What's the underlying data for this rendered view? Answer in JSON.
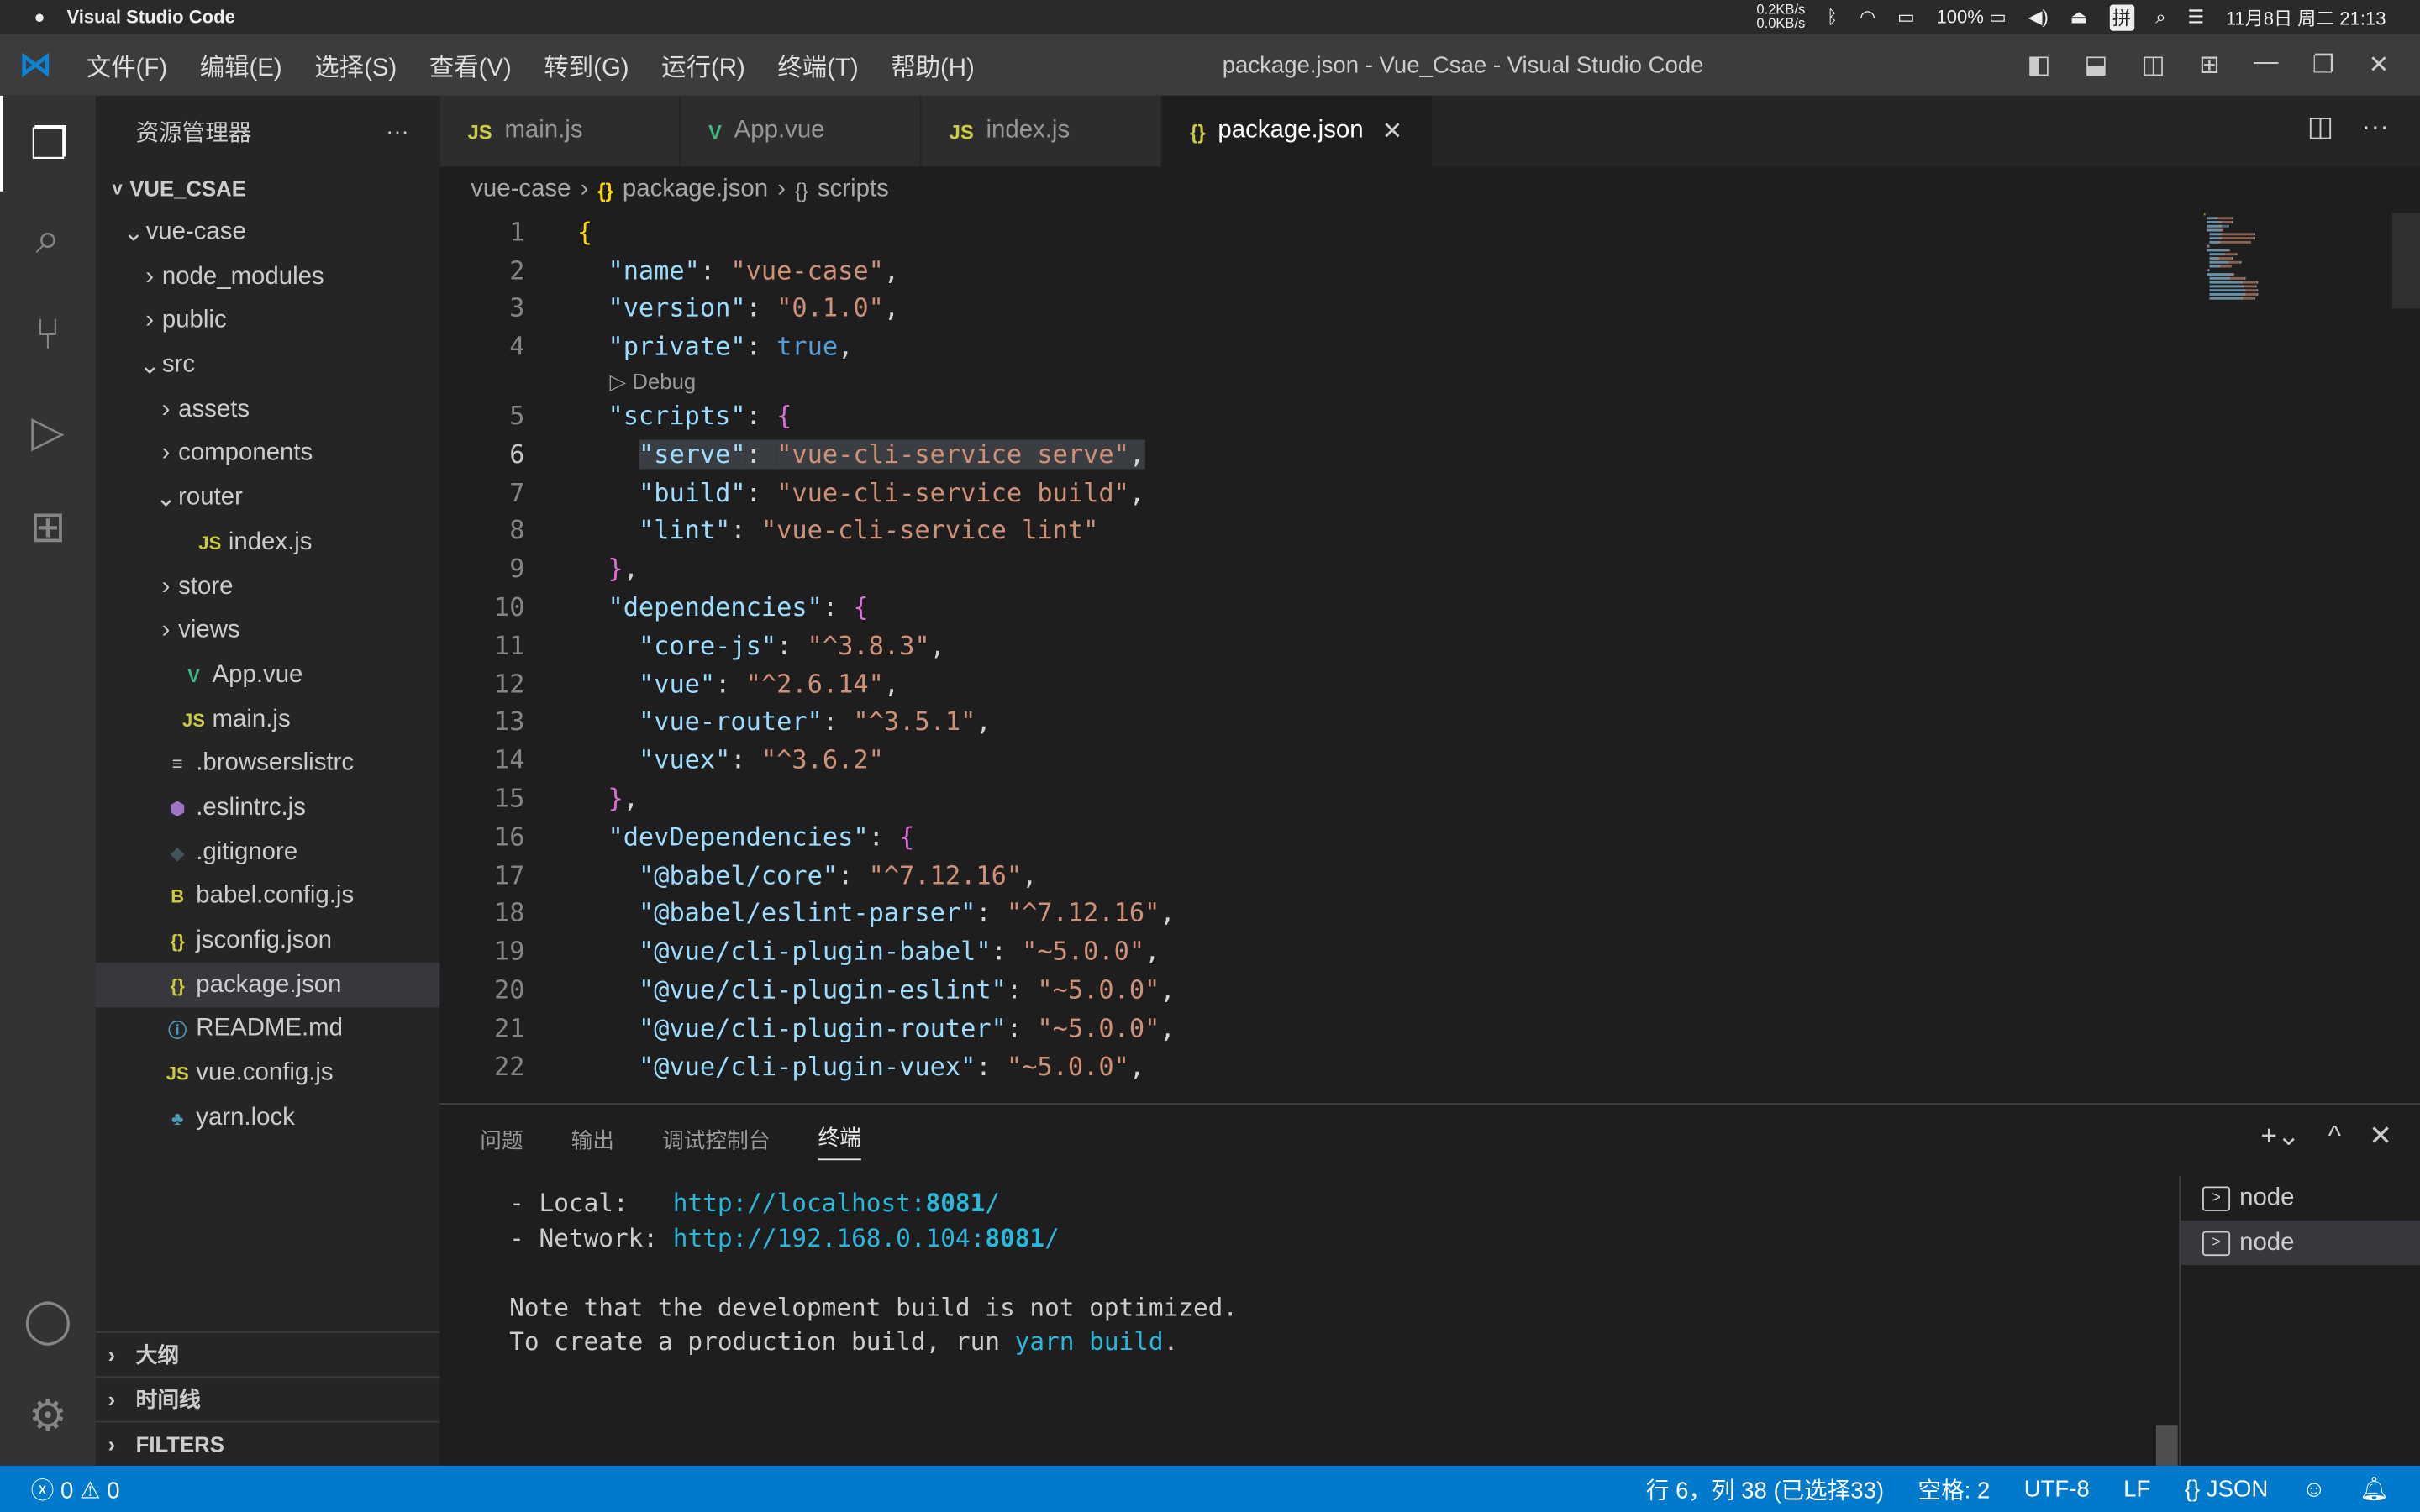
{
  "macbar": {
    "app": "Visual Studio Code",
    "net_up": "0.2KB/s",
    "net_down": "0.0KB/s",
    "battery": "100%",
    "ime": "拼",
    "clock": "11月8日 周二 21:13"
  },
  "titlebar": {
    "menus": [
      "文件(F)",
      "编辑(E)",
      "选择(S)",
      "查看(V)",
      "转到(G)",
      "运行(R)",
      "终端(T)",
      "帮助(H)"
    ],
    "title": "package.json - Vue_Csae - Visual Studio Code"
  },
  "sidebar": {
    "title": "资源管理器",
    "more": "···",
    "root": "VUE_CSAE",
    "tree": [
      {
        "label": "vue-case",
        "indent": 1,
        "chev": "v",
        "icon": "",
        "color": ""
      },
      {
        "label": "node_modules",
        "indent": 2,
        "chev": ">",
        "icon": "",
        "color": ""
      },
      {
        "label": "public",
        "indent": 2,
        "chev": ">",
        "icon": "",
        "color": ""
      },
      {
        "label": "src",
        "indent": 2,
        "chev": "v",
        "icon": "",
        "color": ""
      },
      {
        "label": "assets",
        "indent": 3,
        "chev": ">",
        "icon": "",
        "color": ""
      },
      {
        "label": "components",
        "indent": 3,
        "chev": ">",
        "icon": "",
        "color": ""
      },
      {
        "label": "router",
        "indent": 3,
        "chev": "v",
        "icon": "",
        "color": ""
      },
      {
        "label": "index.js",
        "indent": 4,
        "chev": "",
        "icon": "JS",
        "color": "#cbcb41"
      },
      {
        "label": "store",
        "indent": 3,
        "chev": ">",
        "icon": "",
        "color": ""
      },
      {
        "label": "views",
        "indent": 3,
        "chev": ">",
        "icon": "",
        "color": ""
      },
      {
        "label": "App.vue",
        "indent": 3,
        "chev": "",
        "icon": "V",
        "color": "#41b883"
      },
      {
        "label": "main.js",
        "indent": 3,
        "chev": "",
        "icon": "JS",
        "color": "#cbcb41"
      },
      {
        "label": ".browserslistrc",
        "indent": 2,
        "chev": "",
        "icon": "≡",
        "color": "#ccc"
      },
      {
        "label": ".eslintrc.js",
        "indent": 2,
        "chev": "",
        "icon": "⬢",
        "color": "#a074c4"
      },
      {
        "label": ".gitignore",
        "indent": 2,
        "chev": "",
        "icon": "◆",
        "color": "#41535b"
      },
      {
        "label": "babel.config.js",
        "indent": 2,
        "chev": "",
        "icon": "B",
        "color": "#cbcb41"
      },
      {
        "label": "jsconfig.json",
        "indent": 2,
        "chev": "",
        "icon": "{}",
        "color": "#cbcb41"
      },
      {
        "label": "package.json",
        "indent": 2,
        "chev": "",
        "icon": "{}",
        "color": "#cbcb41",
        "selected": true
      },
      {
        "label": "README.md",
        "indent": 2,
        "chev": "",
        "icon": "ⓘ",
        "color": "#519aba"
      },
      {
        "label": "vue.config.js",
        "indent": 2,
        "chev": "",
        "icon": "JS",
        "color": "#cbcb41"
      },
      {
        "label": "yarn.lock",
        "indent": 2,
        "chev": "",
        "icon": "♣",
        "color": "#519aba"
      }
    ],
    "sections": [
      "大纲",
      "时间线",
      "FILTERS"
    ]
  },
  "tabs": [
    {
      "label": "main.js",
      "icon": "JS",
      "color": "#cbcb41"
    },
    {
      "label": "App.vue",
      "icon": "V",
      "color": "#41b883"
    },
    {
      "label": "index.js",
      "icon": "JS",
      "color": "#cbcb41"
    },
    {
      "label": "package.json",
      "icon": "{}",
      "color": "#cbcb41",
      "active": true
    }
  ],
  "breadcrumb": [
    "vue-case",
    "package.json",
    "scripts"
  ],
  "codelens": "Debug",
  "code": [
    [
      [
        "{",
        "y"
      ]
    ],
    [
      [
        "  ",
        "w"
      ],
      [
        "\"name\"",
        "k"
      ],
      [
        ": ",
        "w"
      ],
      [
        "\"vue-case\"",
        "s"
      ],
      [
        ",",
        "w"
      ]
    ],
    [
      [
        "  ",
        "w"
      ],
      [
        "\"version\"",
        "k"
      ],
      [
        ": ",
        "w"
      ],
      [
        "\"0.1.0\"",
        "s"
      ],
      [
        ",",
        "w"
      ]
    ],
    [
      [
        "  ",
        "w"
      ],
      [
        "\"private\"",
        "k"
      ],
      [
        ": ",
        "w"
      ],
      [
        "true",
        "b"
      ],
      [
        ",",
        "w"
      ]
    ],
    [
      [
        "  ",
        "w"
      ],
      [
        "\"scripts\"",
        "k"
      ],
      [
        ": ",
        "w"
      ],
      [
        "{",
        "p"
      ]
    ],
    [
      [
        "    ",
        "w"
      ],
      [
        "\"serve\"",
        "k"
      ],
      [
        ": ",
        "w"
      ],
      [
        "\"vue-cli-service serve\"",
        "s"
      ],
      [
        ",",
        "w"
      ]
    ],
    [
      [
        "    ",
        "w"
      ],
      [
        "\"build\"",
        "k"
      ],
      [
        ": ",
        "w"
      ],
      [
        "\"vue-cli-service build\"",
        "s"
      ],
      [
        ",",
        "w"
      ]
    ],
    [
      [
        "    ",
        "w"
      ],
      [
        "\"lint\"",
        "k"
      ],
      [
        ": ",
        "w"
      ],
      [
        "\"vue-cli-service lint\"",
        "s"
      ]
    ],
    [
      [
        "  ",
        "w"
      ],
      [
        "}",
        "p"
      ],
      [
        ",",
        "w"
      ]
    ],
    [
      [
        "  ",
        "w"
      ],
      [
        "\"dependencies\"",
        "k"
      ],
      [
        ": ",
        "w"
      ],
      [
        "{",
        "p"
      ]
    ],
    [
      [
        "    ",
        "w"
      ],
      [
        "\"core-js\"",
        "k"
      ],
      [
        ": ",
        "w"
      ],
      [
        "\"^3.8.3\"",
        "s"
      ],
      [
        ",",
        "w"
      ]
    ],
    [
      [
        "    ",
        "w"
      ],
      [
        "\"vue\"",
        "k"
      ],
      [
        ": ",
        "w"
      ],
      [
        "\"^2.6.14\"",
        "s"
      ],
      [
        ",",
        "w"
      ]
    ],
    [
      [
        "    ",
        "w"
      ],
      [
        "\"vue-router\"",
        "k"
      ],
      [
        ": ",
        "w"
      ],
      [
        "\"^3.5.1\"",
        "s"
      ],
      [
        ",",
        "w"
      ]
    ],
    [
      [
        "    ",
        "w"
      ],
      [
        "\"vuex\"",
        "k"
      ],
      [
        ": ",
        "w"
      ],
      [
        "\"^3.6.2\"",
        "s"
      ]
    ],
    [
      [
        "  ",
        "w"
      ],
      [
        "}",
        "p"
      ],
      [
        ",",
        "w"
      ]
    ],
    [
      [
        "  ",
        "w"
      ],
      [
        "\"devDependencies\"",
        "k"
      ],
      [
        ": ",
        "w"
      ],
      [
        "{",
        "p"
      ]
    ],
    [
      [
        "    ",
        "w"
      ],
      [
        "\"@babel/core\"",
        "k"
      ],
      [
        ": ",
        "w"
      ],
      [
        "\"^7.12.16\"",
        "s"
      ],
      [
        ",",
        "w"
      ]
    ],
    [
      [
        "    ",
        "w"
      ],
      [
        "\"@babel/eslint-parser\"",
        "k"
      ],
      [
        ": ",
        "w"
      ],
      [
        "\"^7.12.16\"",
        "s"
      ],
      [
        ",",
        "w"
      ]
    ],
    [
      [
        "    ",
        "w"
      ],
      [
        "\"@vue/cli-plugin-babel\"",
        "k"
      ],
      [
        ": ",
        "w"
      ],
      [
        "\"~5.0.0\"",
        "s"
      ],
      [
        ",",
        "w"
      ]
    ],
    [
      [
        "    ",
        "w"
      ],
      [
        "\"@vue/cli-plugin-eslint\"",
        "k"
      ],
      [
        ": ",
        "w"
      ],
      [
        "\"~5.0.0\"",
        "s"
      ],
      [
        ",",
        "w"
      ]
    ],
    [
      [
        "    ",
        "w"
      ],
      [
        "\"@vue/cli-plugin-router\"",
        "k"
      ],
      [
        ": ",
        "w"
      ],
      [
        "\"~5.0.0\"",
        "s"
      ],
      [
        ",",
        "w"
      ]
    ],
    [
      [
        "    ",
        "w"
      ],
      [
        "\"@vue/cli-plugin-vuex\"",
        "k"
      ],
      [
        ": ",
        "w"
      ],
      [
        "\"~5.0.0\"",
        "s"
      ],
      [
        ",",
        "w"
      ]
    ]
  ],
  "current_line": 6,
  "panel": {
    "tabs": [
      "问题",
      "输出",
      "调试控制台",
      "终端"
    ],
    "active_tab": "终端",
    "terminal": [
      [
        [
          "- Local:   ",
          ""
        ],
        [
          "http://localhost:",
          "u"
        ],
        [
          "8081",
          "ub"
        ],
        [
          "/",
          "u"
        ]
      ],
      [
        [
          "- Network: ",
          ""
        ],
        [
          "http://192.168.0.104:",
          "u"
        ],
        [
          "8081",
          "ub"
        ],
        [
          "/",
          "u"
        ]
      ],
      [
        [
          "",
          ""
        ]
      ],
      [
        [
          "Note that the development build is not optimized.",
          ""
        ]
      ],
      [
        [
          "To create a production build, run ",
          ""
        ],
        [
          "yarn build",
          "u"
        ],
        [
          ".",
          ""
        ]
      ]
    ],
    "terminals": [
      "node",
      "node"
    ]
  },
  "status": {
    "errors": "0",
    "warnings": "0",
    "position": "行 6，列 38 (已选择33)",
    "spaces": "空格: 2",
    "encoding": "UTF-8",
    "eol": "LF",
    "language": "JSON"
  },
  "colors": {
    "statusbar": "#007acc",
    "activity": "#333333",
    "sidebar": "#252526",
    "editor": "#1e1e1e"
  }
}
